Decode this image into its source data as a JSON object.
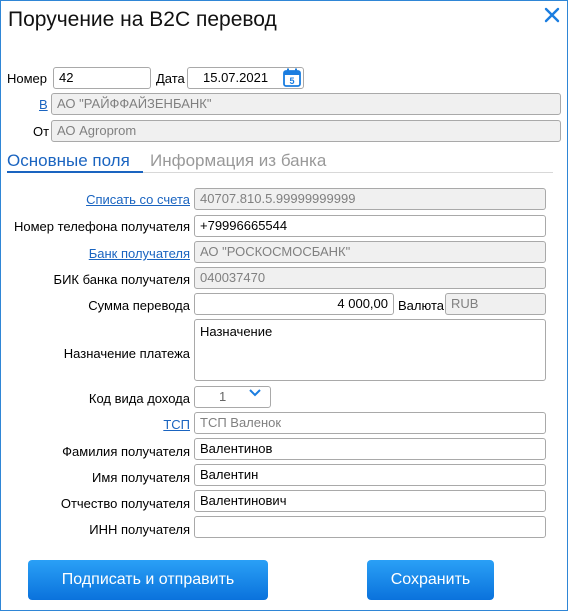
{
  "window": {
    "title": "Поручение на B2C перевод"
  },
  "header": {
    "number_label": "Номер",
    "number_value": "42",
    "date_label": "Дата",
    "date_value": "15.07.2021",
    "to_label": "В",
    "to_value": "АО \"РАЙФФАЙЗЕНБАНК\"",
    "from_label": "От",
    "from_value": "АО Agroprom"
  },
  "tabs": [
    {
      "label": "Основные поля",
      "active": true
    },
    {
      "label": "Информация из банка",
      "active": false
    }
  ],
  "form": {
    "debit_account_label": "Списать со счета",
    "debit_account_value": "40707.810.5.99999999999",
    "phone_label": "Номер телефона получателя",
    "phone_value": "+79996665544",
    "bank_label": "Банк получателя",
    "bank_value": "АО \"РОСКОСМОСБАНК\"",
    "bic_label": "БИК банка получателя",
    "bic_value": "040037470",
    "amount_label": "Сумма перевода",
    "amount_value": "4 000,00",
    "currency_label": "Валюта",
    "currency_value": "RUB",
    "purpose_label": "Назначение платежа",
    "purpose_value": "Назначение",
    "income_code_label": "Код вида дохода",
    "income_code_value": "1",
    "tsp_label": "ТСП",
    "tsp_value": "ТСП Валенок",
    "last_name_label": "Фамилия получателя",
    "last_name_value": "Валентинов",
    "first_name_label": "Имя получателя",
    "first_name_value": "Валентин",
    "patronymic_label": "Отчество получателя",
    "patronymic_value": "Валентинович",
    "inn_label": "ИНН получателя",
    "inn_value": ""
  },
  "buttons": {
    "sign_send": "Подписать и отправить",
    "save": "Сохранить"
  },
  "colors": {
    "accent": "#1a64c0",
    "button": "#0a72dc",
    "border": "#2f86d6"
  },
  "icons": {
    "close": "close-icon",
    "calendar": "calendar-icon",
    "dropdown": "chevron-down-icon"
  }
}
